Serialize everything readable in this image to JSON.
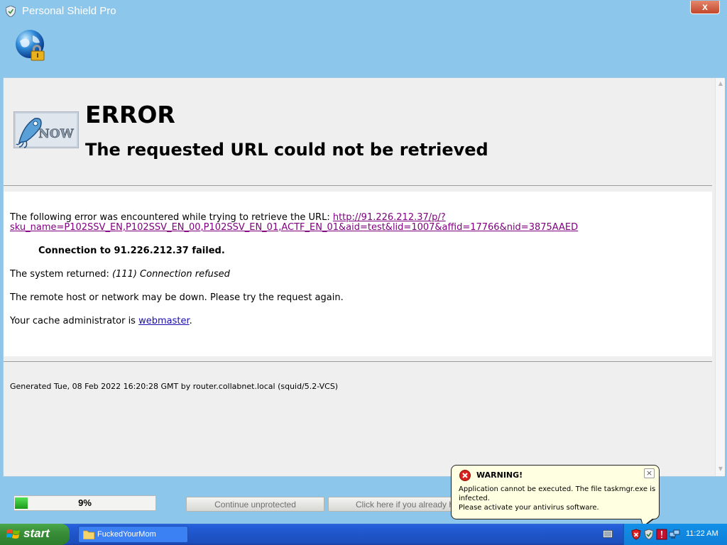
{
  "window": {
    "title": "Personal Shield Pro",
    "close_label": "x"
  },
  "page": {
    "logo_text": "NOW",
    "heading": "ERROR",
    "subheading": "The requested URL could not be retrieved",
    "following_text": "The following error was encountered while trying to retrieve the URL: ",
    "url_part1": "http://91.226.212.37/p/?",
    "url_part2": "sku_name=P102SSV_EN,P102SSV_EN_00,P102SSV_EN_01,ACTF_EN_01&aid=test&lid=1007&affid=17766&nid=3875AAED",
    "connection_failed": "Connection to 91.226.212.37 failed.",
    "system_returned_label": "The system returned: ",
    "system_returned_value": "(111) Connection refused",
    "remote_host": "The remote host or network may be down. Please try the request again.",
    "admin_prefix": "Your cache administrator is ",
    "admin_link": "webmaster",
    "admin_suffix": ".",
    "generated": "Generated Tue, 08 Feb 2022 16:20:28 GMT by router.collabnet.local (squid/5.2-VCS)"
  },
  "controls": {
    "progress_label": "9%",
    "progress_value": 0.09,
    "continue_button": "Continue unprotected",
    "already_button": "Click here if you already h"
  },
  "balloon": {
    "title": "WARNING!",
    "line1": "Application cannot be executed. The file taskmgr.exe is",
    "line2": "infected.",
    "line3": "Please activate your antivirus software.",
    "close_label": "×"
  },
  "taskbar": {
    "start_label": "start",
    "task_item": "FuckedYourMom",
    "clock": "11:22 AM"
  },
  "colors": {
    "window_bg": "#8cc6ea",
    "link_visited": "#800080",
    "link": "#1a0dab",
    "balloon_bg": "#ffffe1",
    "taskbar": "#245edb",
    "start_green": "#3a8f3a",
    "progress_green": "#1a9a1a"
  },
  "icons": [
    "shield-icon",
    "globe-lock-icon",
    "squid-logo",
    "error-icon",
    "close-icon",
    "windows-flag-icon",
    "folder-icon",
    "keyboard-icon",
    "security-shield-icon",
    "network-icon"
  ]
}
